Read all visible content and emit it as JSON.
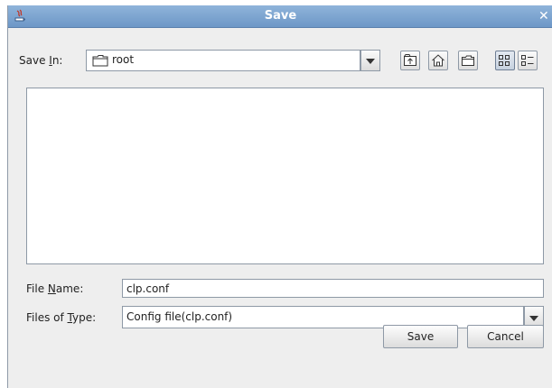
{
  "window": {
    "title": "Save"
  },
  "save_in": {
    "label_pre": "Save ",
    "label_mnemonic": "I",
    "label_post": "n:",
    "value": "root"
  },
  "toolbar": {
    "buttons": [
      {
        "name": "up-one-level",
        "icon": "folder-up-icon"
      },
      {
        "name": "home",
        "icon": "home-icon"
      },
      {
        "name": "new-folder",
        "icon": "new-folder-icon"
      },
      {
        "name": "list-view",
        "icon": "list-view-icon",
        "selected": true
      },
      {
        "name": "details-view",
        "icon": "details-view-icon",
        "selected": false
      }
    ]
  },
  "file_name": {
    "label_pre": "File ",
    "label_mnemonic": "N",
    "label_post": "ame:",
    "value": "clp.conf"
  },
  "file_type": {
    "label_pre": "Files of ",
    "label_mnemonic": "T",
    "label_post": "ype:",
    "value": "Config file(clp.conf)"
  },
  "buttons": {
    "save": "Save",
    "cancel": "Cancel"
  },
  "colors": {
    "title_bar": "#7aa3d0",
    "background": "#eeeeee"
  }
}
